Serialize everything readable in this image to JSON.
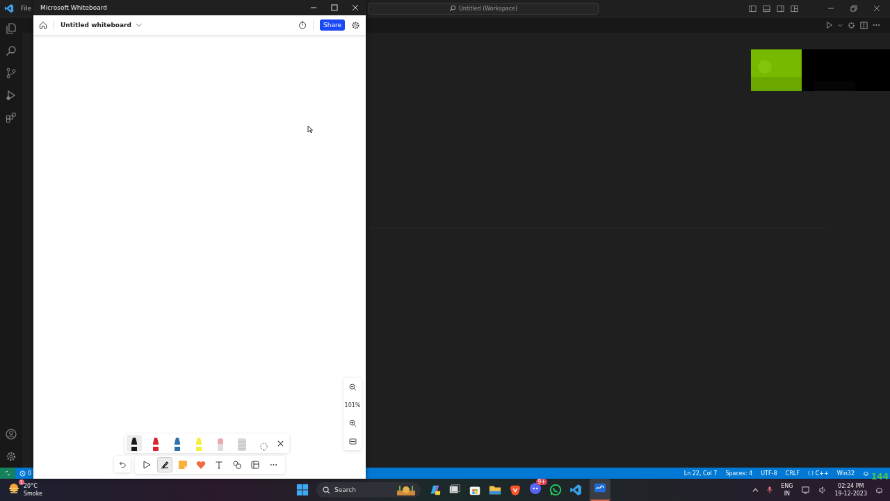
{
  "vscode": {
    "menu": [
      "File"
    ],
    "command_center": "Untitled (Workspace)",
    "status_bar": {
      "errors": "0",
      "items": [
        "Ln 22, Col 7",
        "Spaces: 4",
        "UTF-8",
        "CRLF",
        "C++",
        "Win32"
      ]
    }
  },
  "fps_counter": "144",
  "whiteboard": {
    "window_title": "Microsoft Whiteboard",
    "board_title": "Untitled whiteboard",
    "share": "Share",
    "zoom": "101%",
    "pens": [
      {
        "kind": "pen",
        "color": "#1a1a1a",
        "selected": true
      },
      {
        "kind": "pen",
        "color": "#d9232e",
        "selected": false
      },
      {
        "kind": "pen",
        "color": "#2f6fb0",
        "selected": false
      },
      {
        "kind": "highlighter",
        "color": "#f5ef3a",
        "selected": false
      },
      {
        "kind": "eraser",
        "color": "#e8a9b4",
        "selected": false
      },
      {
        "kind": "ruler",
        "color": "#d8d8d8",
        "selected": false
      },
      {
        "kind": "lasso",
        "selected": false
      }
    ],
    "tools": [
      {
        "kind": "select",
        "selected": false
      },
      {
        "kind": "pen",
        "selected": true
      },
      {
        "kind": "note",
        "selected": false
      },
      {
        "kind": "reaction",
        "selected": false
      },
      {
        "kind": "text",
        "selected": false
      },
      {
        "kind": "shapes",
        "selected": false
      },
      {
        "kind": "template",
        "selected": false
      },
      {
        "kind": "more",
        "selected": false
      }
    ]
  },
  "taskbar": {
    "weather": {
      "temp": "20°C",
      "condition": "Smoke",
      "badge": "1"
    },
    "search": "Search",
    "discord_badge": "9+",
    "language": [
      "ENG",
      "IN"
    ],
    "time": "02:24 PM",
    "date": "19-12-2023"
  }
}
